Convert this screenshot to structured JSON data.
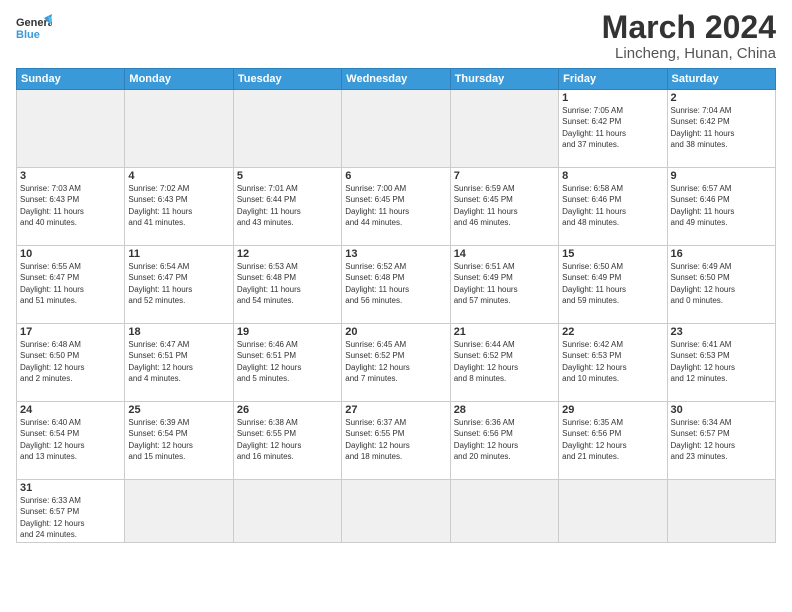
{
  "header": {
    "logo_general": "General",
    "logo_blue": "Blue",
    "title": "March 2024",
    "subtitle": "Lincheng, Hunan, China"
  },
  "weekdays": [
    "Sunday",
    "Monday",
    "Tuesday",
    "Wednesday",
    "Thursday",
    "Friday",
    "Saturday"
  ],
  "weeks": [
    [
      {
        "day": "",
        "info": ""
      },
      {
        "day": "",
        "info": ""
      },
      {
        "day": "",
        "info": ""
      },
      {
        "day": "",
        "info": ""
      },
      {
        "day": "",
        "info": ""
      },
      {
        "day": "1",
        "info": "Sunrise: 7:05 AM\nSunset: 6:42 PM\nDaylight: 11 hours\nand 37 minutes."
      },
      {
        "day": "2",
        "info": "Sunrise: 7:04 AM\nSunset: 6:42 PM\nDaylight: 11 hours\nand 38 minutes."
      }
    ],
    [
      {
        "day": "3",
        "info": "Sunrise: 7:03 AM\nSunset: 6:43 PM\nDaylight: 11 hours\nand 40 minutes."
      },
      {
        "day": "4",
        "info": "Sunrise: 7:02 AM\nSunset: 6:43 PM\nDaylight: 11 hours\nand 41 minutes."
      },
      {
        "day": "5",
        "info": "Sunrise: 7:01 AM\nSunset: 6:44 PM\nDaylight: 11 hours\nand 43 minutes."
      },
      {
        "day": "6",
        "info": "Sunrise: 7:00 AM\nSunset: 6:45 PM\nDaylight: 11 hours\nand 44 minutes."
      },
      {
        "day": "7",
        "info": "Sunrise: 6:59 AM\nSunset: 6:45 PM\nDaylight: 11 hours\nand 46 minutes."
      },
      {
        "day": "8",
        "info": "Sunrise: 6:58 AM\nSunset: 6:46 PM\nDaylight: 11 hours\nand 48 minutes."
      },
      {
        "day": "9",
        "info": "Sunrise: 6:57 AM\nSunset: 6:46 PM\nDaylight: 11 hours\nand 49 minutes."
      }
    ],
    [
      {
        "day": "10",
        "info": "Sunrise: 6:55 AM\nSunset: 6:47 PM\nDaylight: 11 hours\nand 51 minutes."
      },
      {
        "day": "11",
        "info": "Sunrise: 6:54 AM\nSunset: 6:47 PM\nDaylight: 11 hours\nand 52 minutes."
      },
      {
        "day": "12",
        "info": "Sunrise: 6:53 AM\nSunset: 6:48 PM\nDaylight: 11 hours\nand 54 minutes."
      },
      {
        "day": "13",
        "info": "Sunrise: 6:52 AM\nSunset: 6:48 PM\nDaylight: 11 hours\nand 56 minutes."
      },
      {
        "day": "14",
        "info": "Sunrise: 6:51 AM\nSunset: 6:49 PM\nDaylight: 11 hours\nand 57 minutes."
      },
      {
        "day": "15",
        "info": "Sunrise: 6:50 AM\nSunset: 6:49 PM\nDaylight: 11 hours\nand 59 minutes."
      },
      {
        "day": "16",
        "info": "Sunrise: 6:49 AM\nSunset: 6:50 PM\nDaylight: 12 hours\nand 0 minutes."
      }
    ],
    [
      {
        "day": "17",
        "info": "Sunrise: 6:48 AM\nSunset: 6:50 PM\nDaylight: 12 hours\nand 2 minutes."
      },
      {
        "day": "18",
        "info": "Sunrise: 6:47 AM\nSunset: 6:51 PM\nDaylight: 12 hours\nand 4 minutes."
      },
      {
        "day": "19",
        "info": "Sunrise: 6:46 AM\nSunset: 6:51 PM\nDaylight: 12 hours\nand 5 minutes."
      },
      {
        "day": "20",
        "info": "Sunrise: 6:45 AM\nSunset: 6:52 PM\nDaylight: 12 hours\nand 7 minutes."
      },
      {
        "day": "21",
        "info": "Sunrise: 6:44 AM\nSunset: 6:52 PM\nDaylight: 12 hours\nand 8 minutes."
      },
      {
        "day": "22",
        "info": "Sunrise: 6:42 AM\nSunset: 6:53 PM\nDaylight: 12 hours\nand 10 minutes."
      },
      {
        "day": "23",
        "info": "Sunrise: 6:41 AM\nSunset: 6:53 PM\nDaylight: 12 hours\nand 12 minutes."
      }
    ],
    [
      {
        "day": "24",
        "info": "Sunrise: 6:40 AM\nSunset: 6:54 PM\nDaylight: 12 hours\nand 13 minutes."
      },
      {
        "day": "25",
        "info": "Sunrise: 6:39 AM\nSunset: 6:54 PM\nDaylight: 12 hours\nand 15 minutes."
      },
      {
        "day": "26",
        "info": "Sunrise: 6:38 AM\nSunset: 6:55 PM\nDaylight: 12 hours\nand 16 minutes."
      },
      {
        "day": "27",
        "info": "Sunrise: 6:37 AM\nSunset: 6:55 PM\nDaylight: 12 hours\nand 18 minutes."
      },
      {
        "day": "28",
        "info": "Sunrise: 6:36 AM\nSunset: 6:56 PM\nDaylight: 12 hours\nand 20 minutes."
      },
      {
        "day": "29",
        "info": "Sunrise: 6:35 AM\nSunset: 6:56 PM\nDaylight: 12 hours\nand 21 minutes."
      },
      {
        "day": "30",
        "info": "Sunrise: 6:34 AM\nSunset: 6:57 PM\nDaylight: 12 hours\nand 23 minutes."
      }
    ],
    [
      {
        "day": "31",
        "info": "Sunrise: 6:33 AM\nSunset: 6:57 PM\nDaylight: 12 hours\nand 24 minutes."
      },
      {
        "day": "",
        "info": ""
      },
      {
        "day": "",
        "info": ""
      },
      {
        "day": "",
        "info": ""
      },
      {
        "day": "",
        "info": ""
      },
      {
        "day": "",
        "info": ""
      },
      {
        "day": "",
        "info": ""
      }
    ]
  ]
}
